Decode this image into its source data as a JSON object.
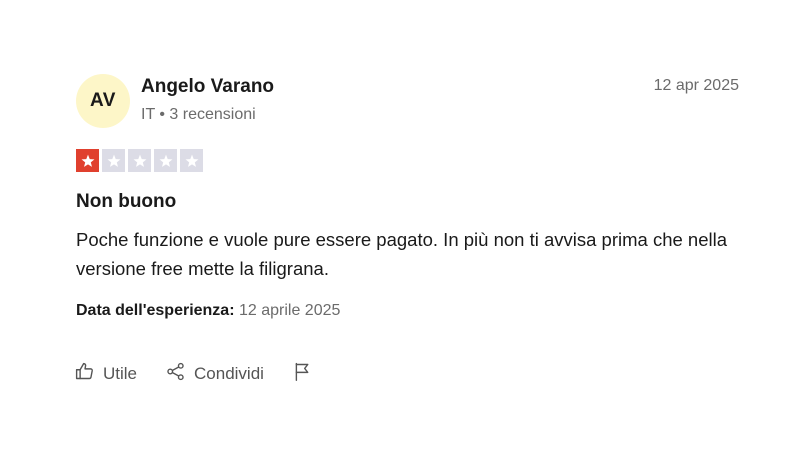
{
  "author": {
    "initials": "AV",
    "name": "Angelo Varano",
    "meta": "IT • 3 recensioni",
    "avatar_color": "#fdf6c8"
  },
  "review": {
    "date": "12 apr 2025",
    "rating": 1,
    "rating_max": 5,
    "star_color": "#e0402e",
    "title": "Non buono",
    "body": "Poche funzione e vuole pure essere pagato. In più non ti avvisa prima che nella versione free mette la filigrana.",
    "experience_label": "Data dell'esperienza:",
    "experience_date": "12 aprile 2025"
  },
  "actions": {
    "useful_label": "Utile",
    "useful_icon": "thumbs-up-icon",
    "share_label": "Condividi",
    "share_icon": "share-icon",
    "report_icon": "flag-icon"
  }
}
